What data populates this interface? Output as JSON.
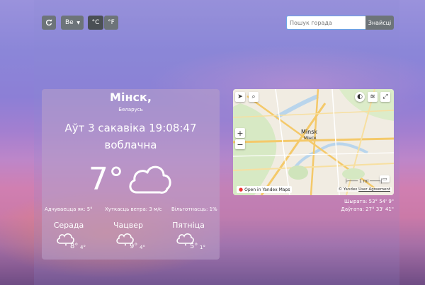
{
  "toolbar": {
    "refresh_icon": "refresh-icon",
    "language": "Be",
    "unit_c": "°C",
    "unit_f": "°F"
  },
  "search": {
    "placeholder": "Пошук горада",
    "button": "Знайсці"
  },
  "weather": {
    "city": "Мінск,",
    "country": "Беларусь",
    "datetime": "Аўт 3 сакавіка 19:08:47",
    "condition": "воблачна",
    "temperature": "7°",
    "icon": "cloud-icon",
    "feels_like": "Адчуваецца як: 5°",
    "wind": "Хуткасць ветра: 3 м/с",
    "humidity": "Вільготнасць: 1%"
  },
  "forecast": [
    {
      "day": "Серада",
      "high": "8°",
      "low": "4°",
      "icon": "cloud-rain-icon"
    },
    {
      "day": "Чацвер",
      "high": "9°",
      "low": "4°",
      "icon": "cloud-rain-icon"
    },
    {
      "day": "Пятніца",
      "high": "5°",
      "low": "1°",
      "icon": "cloud-rain-icon"
    }
  ],
  "map": {
    "city_label": "Minsk",
    "city_label_local": "Мінск",
    "open_link": "Open in Yandex Maps",
    "copyright": "© Yandex",
    "agreement": "User Agreement",
    "scale_label": "1 mi",
    "controls": {
      "locate": "locate-arrow-icon",
      "search": "search-icon",
      "traffic": "traffic-icon",
      "layers": "layers-icon",
      "fullscreen": "fullscreen-icon",
      "zoom_in": "+",
      "zoom_out": "−"
    }
  },
  "coordinates": {
    "latitude": "Шырата: 53° 54' 9\"",
    "longitude": "Даўгата: 27° 33' 41\""
  }
}
